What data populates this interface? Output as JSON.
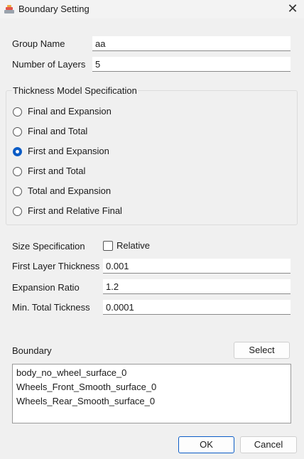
{
  "window": {
    "title": "Boundary Setting",
    "close_glyph": "✕",
    "icon": "app-icon"
  },
  "group_name": {
    "label": "Group Name",
    "value": "aa"
  },
  "number_of_layers": {
    "label": "Number of Layers",
    "value": "5"
  },
  "thickness_model": {
    "title": "Thickness Model Specification",
    "options": [
      {
        "label": "Final and Expansion",
        "checked": false
      },
      {
        "label": "Final and Total",
        "checked": false
      },
      {
        "label": "First and Expansion",
        "checked": true
      },
      {
        "label": "First and Total",
        "checked": false
      },
      {
        "label": "Total and Expansion",
        "checked": false
      },
      {
        "label": "First and Relative Final",
        "checked": false
      }
    ]
  },
  "size_specification": {
    "label": "Size Specification",
    "relative_label": "Relative",
    "relative_checked": false
  },
  "first_layer_thickness": {
    "label": "First Layer Thickness",
    "value": "0.001"
  },
  "expansion_ratio": {
    "label": "Expansion Ratio",
    "value": "1.2"
  },
  "min_total_thickness": {
    "label": "Min. Total Tickness",
    "value": "0.0001"
  },
  "boundary": {
    "label": "Boundary",
    "select_label": "Select",
    "items": [
      "body_no_wheel_surface_0",
      "Wheels_Front_Smooth_surface_0",
      "Wheels_Rear_Smooth_surface_0"
    ]
  },
  "buttons": {
    "ok": "OK",
    "cancel": "Cancel"
  },
  "colors": {
    "accent": "#0b5cc6",
    "background": "#f0f0f0"
  }
}
